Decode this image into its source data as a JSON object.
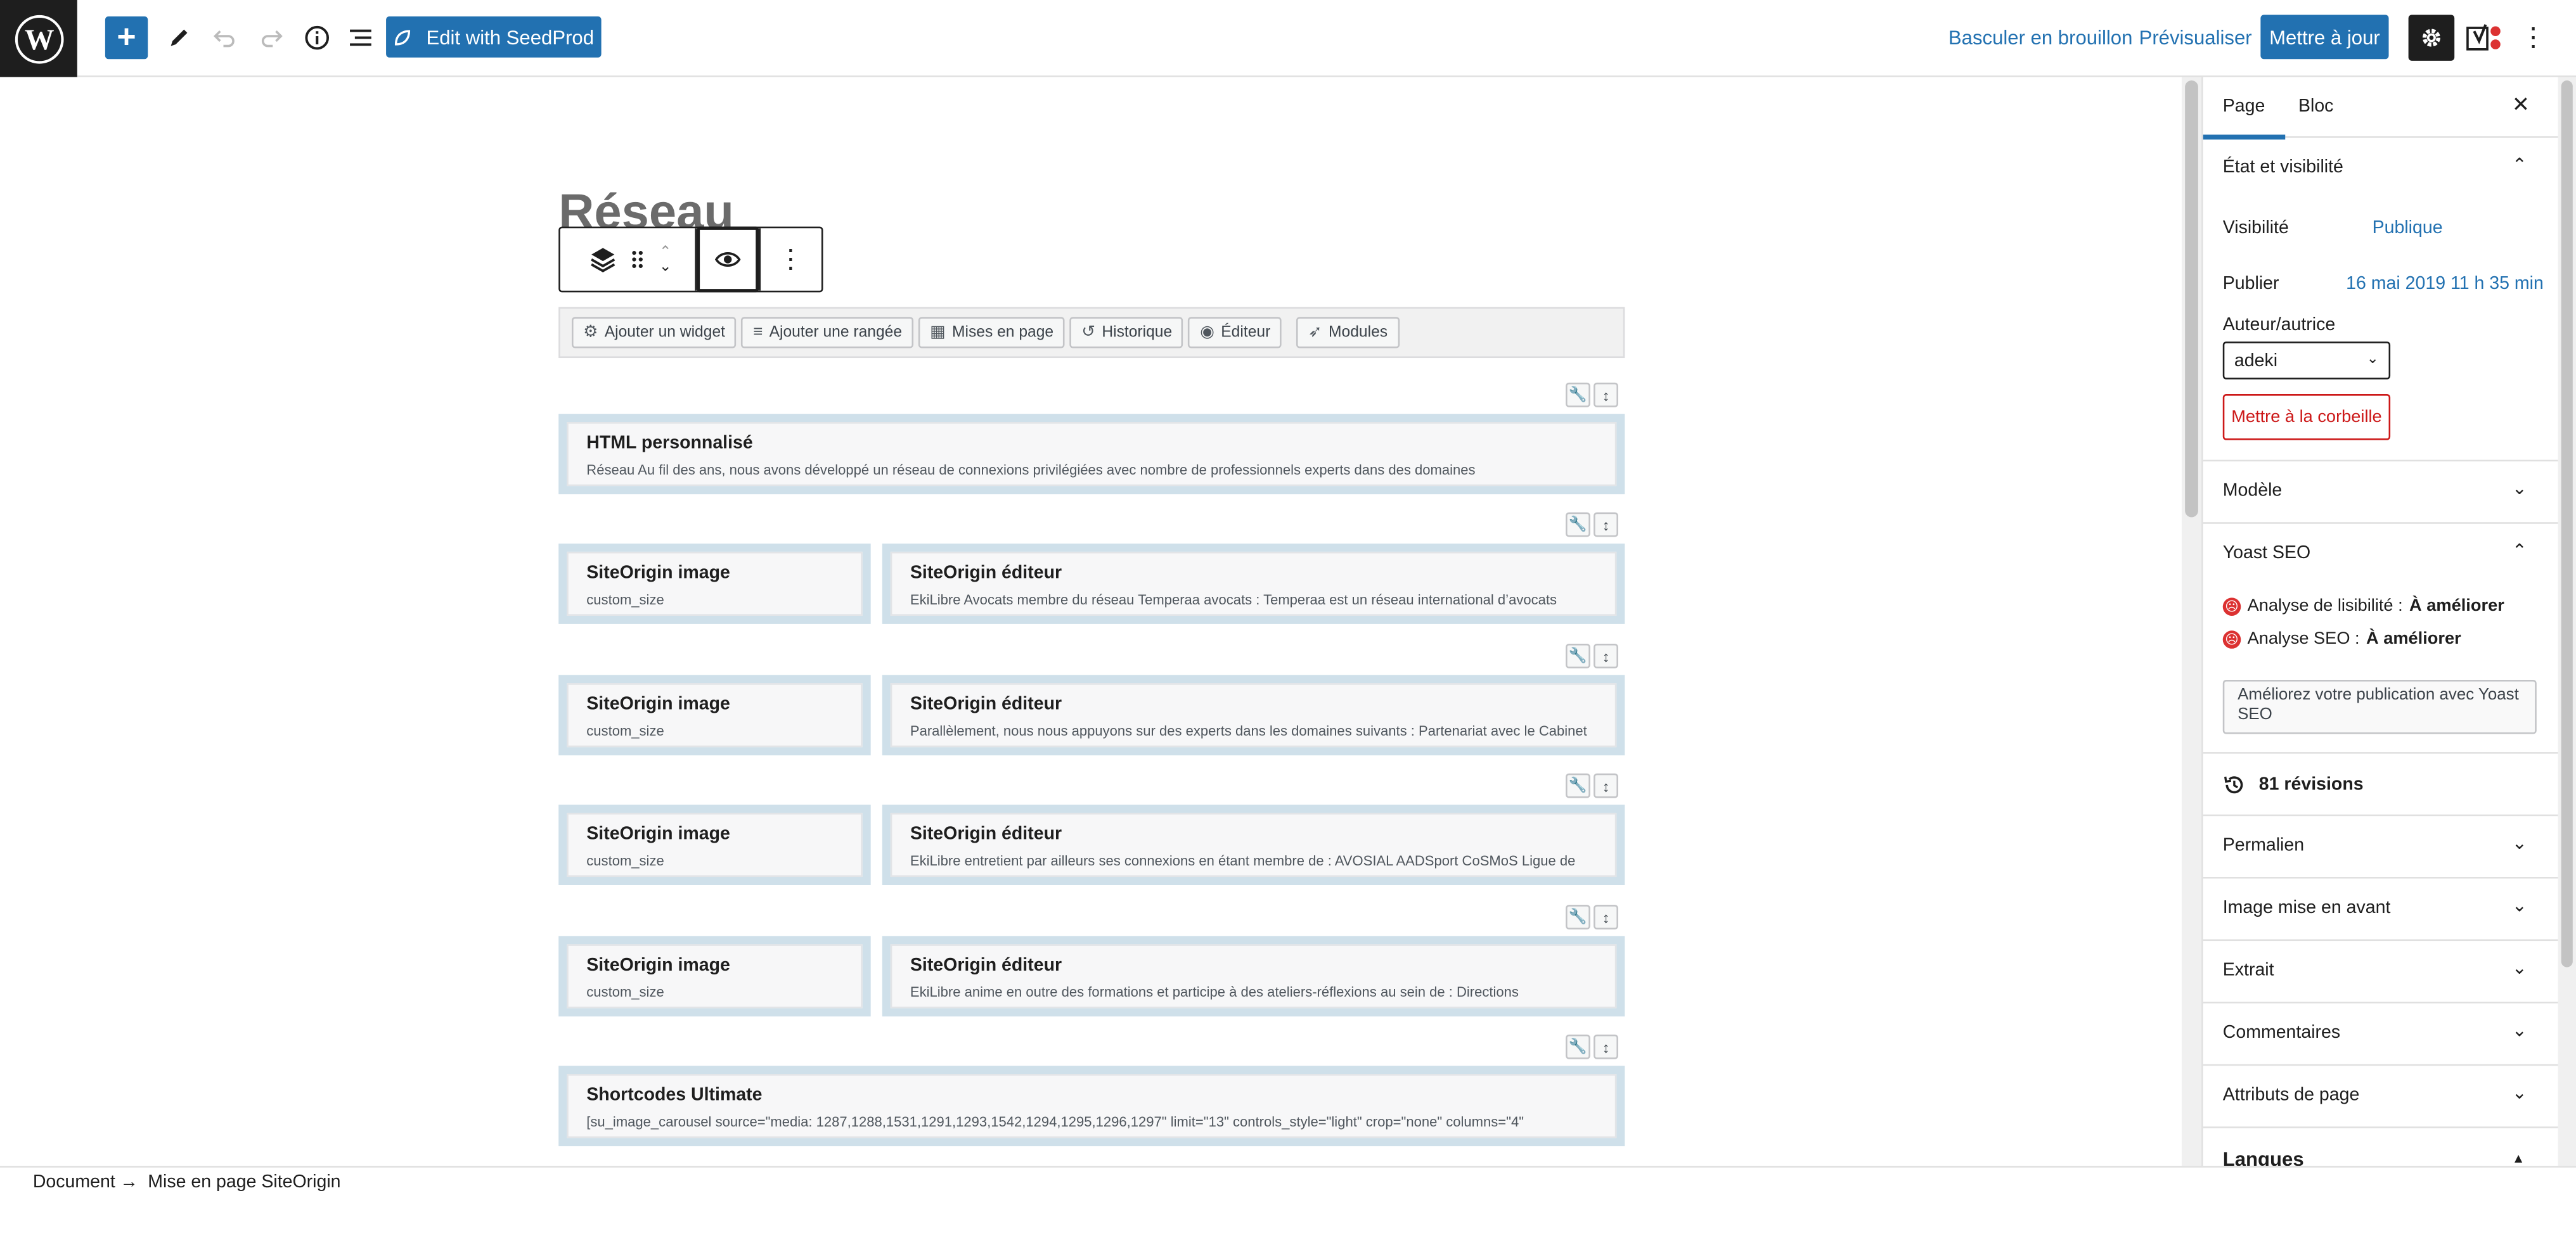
{
  "topbar": {
    "add_label": "+",
    "seedprod_label": "Edit with SeedProd",
    "switch_draft": "Basculer en brouillon",
    "preview": "Prévisualiser",
    "update": "Mettre à jour"
  },
  "editor": {
    "page_title": "Réseau",
    "so_toolbar": [
      "Ajouter un widget",
      "Ajouter une rangée",
      "Mises en page",
      "Historique",
      "Éditeur",
      "Modules"
    ],
    "rows": [
      {
        "cells": [
          {
            "title": "HTML personnalisé",
            "desc": "Réseau Au fil des ans, nous avons développé un réseau de connexions privilégiées avec nombre de professionnels experts dans des domaines"
          }
        ]
      },
      {
        "cells": [
          {
            "title": "SiteOrigin image",
            "desc": "custom_size"
          },
          {
            "title": "SiteOrigin éditeur",
            "desc": "EkiLibre Avocats membre du réseau Temperaa avocats : Temperaa est un réseau international d’avocats"
          }
        ]
      },
      {
        "cells": [
          {
            "title": "SiteOrigin image",
            "desc": "custom_size"
          },
          {
            "title": "SiteOrigin éditeur",
            "desc": "Parallèlement, nous nous appuyons sur des experts dans les domaines suivants : Partenariat avec le Cabinet"
          }
        ]
      },
      {
        "cells": [
          {
            "title": "SiteOrigin image",
            "desc": "custom_size"
          },
          {
            "title": "SiteOrigin éditeur",
            "desc": "EkiLibre entretient par ailleurs ses connexions en étant membre de : AVOSIAL AADSport CoSMoS Ligue de"
          }
        ]
      },
      {
        "cells": [
          {
            "title": "SiteOrigin image",
            "desc": "custom_size"
          },
          {
            "title": "SiteOrigin éditeur",
            "desc": "EkiLibre anime en outre des formations et participe à des ateliers-réflexions au sein de : Directions"
          }
        ]
      },
      {
        "cells": [
          {
            "title": "Shortcodes Ultimate",
            "desc": "[su_image_carousel source=\"media: 1287,1288,1531,1291,1293,1542,1294,1295,1296,1297\" limit=\"13\" controls_style=\"light\" crop=\"none\" columns=\"4\""
          }
        ]
      }
    ]
  },
  "sidebar": {
    "tab_page": "Page",
    "tab_block": "Bloc",
    "status_panel": "État et visibilité",
    "visibility_label": "Visibilité",
    "visibility_value": "Publique",
    "publish_label": "Publier",
    "publish_value": "16 mai 2019 11 h 35 min",
    "author_label": "Auteur/autrice",
    "author_value": "adeki",
    "trash": "Mettre à la corbeille",
    "template_panel": "Modèle",
    "yoast_panel": "Yoast SEO",
    "readability_prefix": "Analyse de lisibilité :",
    "readability_value": "À améliorer",
    "seo_prefix": "Analyse SEO :",
    "seo_value": "À améliorer",
    "yoast_improve": "Améliorez votre publication avec Yoast SEO",
    "revisions": "81 révisions",
    "panels": [
      "Permalien",
      "Image mise en avant",
      "Extrait",
      "Commentaires",
      "Attributs de page"
    ],
    "languages": "Langues"
  },
  "footer": {
    "crumb_1": "Document",
    "crumb_2": "Mise en page SiteOrigin"
  }
}
